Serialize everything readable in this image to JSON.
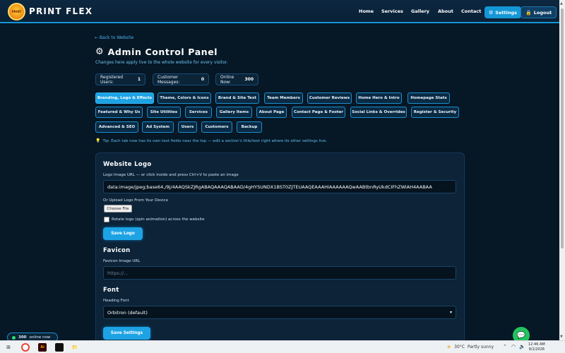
{
  "nav": {
    "logo_text": "PRINT",
    "brand": "PRINT FLEX",
    "links": [
      "Home",
      "Services",
      "Gallery",
      "About",
      "Contact"
    ],
    "settings_label": "Settings",
    "logout_label": "Logout"
  },
  "header": {
    "back_link": "← Back to Website",
    "title": "Admin Control Panel",
    "subtitle": "Changes here apply live to the whole website for every visitor."
  },
  "stats": [
    {
      "label": "Registered Users:",
      "value": "1"
    },
    {
      "label": "Customer Messages:",
      "value": "0"
    },
    {
      "label": "Online Now:",
      "value": "300"
    }
  ],
  "tabs": [
    "Branding, Logo & Effects",
    "Theme, Colors & Icons",
    "Brand & Site Text",
    "Team Members",
    "Customer Reviews",
    "Home Hero & Intro",
    "Homepage Stats",
    "Featured & Why Us",
    "Site Utilities",
    "Services",
    "Gallery Items",
    "About Page",
    "Contact Page & Footer",
    "Social Links & Overrides",
    "Register & Security",
    "Advanced & SEO",
    "Ad System",
    "Users",
    "Customers",
    "Backup"
  ],
  "active_tab_index": 0,
  "tip": "Tip: Each tab now has its own text fields near the top — edit a section's title/text right where its other settings live.",
  "logo_section": {
    "heading": "Website Logo",
    "url_label": "Logo Image URL — or click inside and press Ctrl+V to paste an image",
    "url_value": "data:image/jpeg;base64,/9j/4AAQSkZJRgABAQAAAQABAAD/4gHYSUNDX1BST0ZJTEUAAQEAAAHIAAAAAAQwAABtbnRyUkdCIFhZWiAH4AABAA",
    "upload_label": "Or Upload Logo From Your Device",
    "choose_file": "Choose File",
    "rotate_label": "Rotate logo (spin animation) across the website",
    "rotate_checked": false,
    "save_button": "Save Logo"
  },
  "favicon_section": {
    "heading": "Favicon",
    "url_label": "Favicon Image URL",
    "placeholder": "https://..."
  },
  "font_section": {
    "heading": "Font",
    "label": "Heading Font",
    "selected": "Orbitron (default)",
    "save_button": "Save Settings"
  },
  "widgets": {
    "online_count": "300",
    "online_text": "online now"
  },
  "taskbar": {
    "temperature": "30°C",
    "weather": "Partly sunny",
    "time": "12:46 AM",
    "date": "9/1/2026"
  }
}
